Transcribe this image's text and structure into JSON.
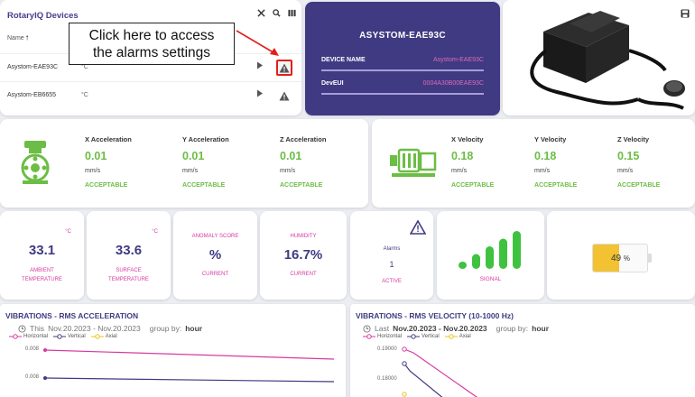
{
  "device_list": {
    "title": "RotaryIQ Devices",
    "column_header": "Name",
    "devices": [
      {
        "name": "Asystom-EAE93C",
        "unit": "°C"
      },
      {
        "name": "Asystom-EB6655",
        "unit": "°C"
      }
    ]
  },
  "callout": {
    "line1": "Click here to access",
    "line2": "the alarms settings"
  },
  "device_info": {
    "device_title": "ASYSTOM-EAE93C",
    "name_label": "DEVICE NAME",
    "name_value": "Asystom-EAE93C",
    "eui_label": "DevEUI",
    "eui_value": "0004A30B00EAE93C"
  },
  "acceleration": [
    {
      "label": "X Acceleration",
      "value": "0.01",
      "unit": "mm/s",
      "status": "ACCEPTABLE"
    },
    {
      "label": "Y Acceleration",
      "value": "0.01",
      "unit": "mm/s",
      "status": "ACCEPTABLE"
    },
    {
      "label": "Z Acceleration",
      "value": "0.01",
      "unit": "mm/s",
      "status": "ACCEPTABLE"
    }
  ],
  "velocity": [
    {
      "label": "X Velocity",
      "value": "0.18",
      "unit": "mm/s",
      "status": "ACCEPTABLE"
    },
    {
      "label": "Y Velocity",
      "value": "0.18",
      "unit": "mm/s",
      "status": "ACCEPTABLE"
    },
    {
      "label": "Z Velocity",
      "value": "0.15",
      "unit": "mm/s",
      "status": "ACCEPTABLE"
    }
  ],
  "ambient": {
    "value": "33.1",
    "unit": "°C",
    "caption1": "AMBIENT",
    "caption2": "TEMPERATURE"
  },
  "surface": {
    "value": "33.6",
    "unit": "°C",
    "caption1": "SURFACE",
    "caption2": "TEMPERATURE"
  },
  "anomaly": {
    "title": "ANOMALY SCORE",
    "value": "%",
    "caption": "CURRENT"
  },
  "humidity": {
    "title": "HUMIDITY",
    "value": "16.7%",
    "caption": "CURRENT"
  },
  "alarms": {
    "label": "Alarms",
    "count": "1",
    "caption": "ACTIVE"
  },
  "signal": {
    "label": "SIGNAL",
    "bars_active": 5,
    "bars_total": 5
  },
  "battery": {
    "percent_text": "49",
    "unit": "%",
    "level": 0.49
  },
  "vibration_accel": {
    "title": "VIBRATIONS - RMS ACCELERATION",
    "range_label": "This",
    "range": "Nov.20.2023 - Nov.20.2023",
    "group_label": "group by:",
    "group_value": "hour",
    "legend": [
      "Horizontal",
      "Vertical",
      "Axial"
    ],
    "y_ticks": [
      "0.008",
      "0.008"
    ]
  },
  "vibration_velocity": {
    "title": "VIBRATIONS - RMS VELOCITY (10-1000 Hz)",
    "range_label": "Last",
    "range": "Nov.20.2023 - Nov.20.2023",
    "group_label": "group by:",
    "group_value": "hour",
    "legend": [
      "Horizontal",
      "Vertical",
      "Axial"
    ],
    "y_ticks": [
      "0.19000",
      "0.18000"
    ]
  },
  "colors": {
    "horizontal": "#d63aa0",
    "vertical": "#3f3a82",
    "axial": "#e8c516",
    "accent": "#3f3a82",
    "ok": "#6cbd45",
    "highlight": "#e0201c"
  }
}
